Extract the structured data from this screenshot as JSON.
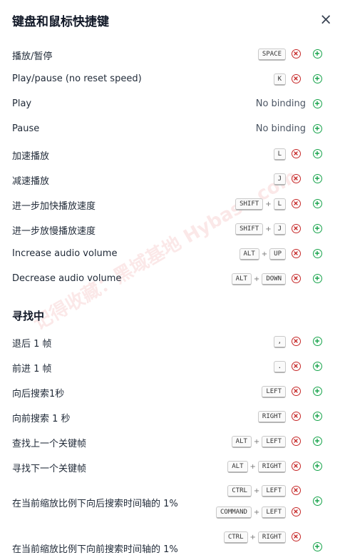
{
  "title": "键盘和鼠标快捷键",
  "close_label": "×",
  "watermark": "记得收藏：黑域基地 Hybase.com",
  "no_binding": "No binding",
  "plus": "+",
  "group1": [
    {
      "label": "播放/暂停",
      "keys": [
        "SPACE"
      ]
    },
    {
      "label": "Play/pause (no reset speed)",
      "keys": [
        "K"
      ]
    },
    {
      "label": "Play",
      "keys": []
    },
    {
      "label": "Pause",
      "keys": []
    },
    {
      "label": "加速播放",
      "keys": [
        "L"
      ]
    },
    {
      "label": "减速播放",
      "keys": [
        "J"
      ]
    },
    {
      "label": "进一步加快播放速度",
      "keys": [
        "SHIFT",
        "L"
      ]
    },
    {
      "label": "进一步放慢播放速度",
      "keys": [
        "SHIFT",
        "J"
      ]
    },
    {
      "label": "Increase audio volume",
      "keys": [
        "ALT",
        "UP"
      ]
    },
    {
      "label": "Decrease audio volume",
      "keys": [
        "ALT",
        "DOWN"
      ]
    }
  ],
  "section2_title": "寻找中",
  "group2": [
    {
      "label": "退后 1 帧",
      "keys": [
        ","
      ]
    },
    {
      "label": "前进 1 帧",
      "keys": [
        "."
      ]
    },
    {
      "label": "向后搜索1秒",
      "keys": [
        "LEFT"
      ]
    },
    {
      "label": "向前搜索 1 秒",
      "keys": [
        "RIGHT"
      ]
    },
    {
      "label": "查找上一个关键帧",
      "keys": [
        "ALT",
        "LEFT"
      ]
    },
    {
      "label": "寻找下一个关键帧",
      "keys": [
        "ALT",
        "RIGHT"
      ]
    }
  ],
  "multi1": {
    "label": "在当前缩放比例下向后搜索时间轴的 1%",
    "bindings": [
      [
        "CTRL",
        "LEFT"
      ],
      [
        "COMMAND",
        "LEFT"
      ]
    ]
  },
  "multi2": {
    "label": "在当前缩放比例下向前搜索时间轴的 1%",
    "bindings": [
      [
        "CTRL",
        "RIGHT"
      ]
    ]
  }
}
